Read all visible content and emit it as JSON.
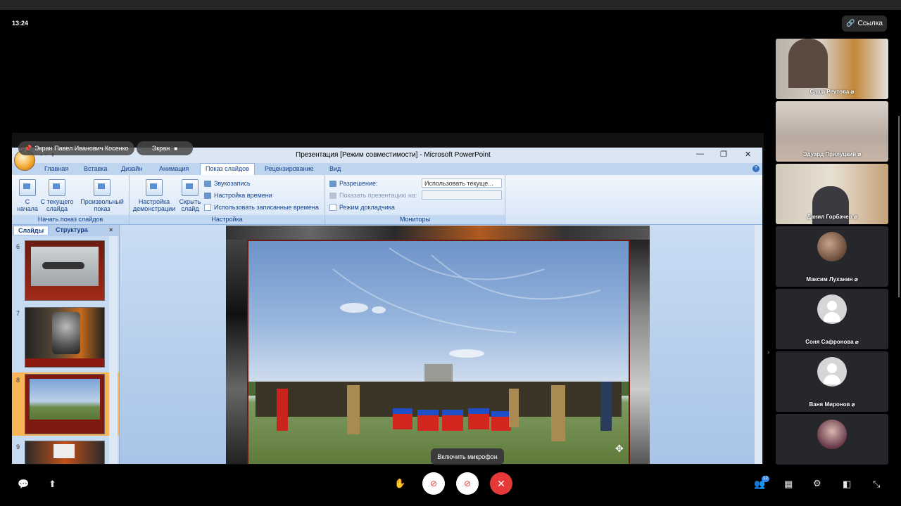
{
  "status": {
    "time": "13:24"
  },
  "header": {
    "link_button": "Ссылка"
  },
  "share": {
    "presenter_label": "Экран Павел Иванович Косенко",
    "screen_label": "Экран"
  },
  "ppt": {
    "window_title": "Презентация [Режим совместимости] - Microsoft PowerPoint",
    "tabs": [
      "Главная",
      "Вставка",
      "Дизайн",
      "Анимация",
      "Показ слайдов",
      "Рецензирование",
      "Вид"
    ],
    "active_tab": "Показ слайдов",
    "ribbon": {
      "start_group_title": "Начать показ слайдов",
      "from_start": "С начала",
      "from_current": "С текущего слайда",
      "custom_show": "Произвольный показ",
      "setup_group_title": "Настройка",
      "setup_show": "Настройка демонстрации",
      "hide_slide": "Скрыть слайд",
      "record_narration": "Звукозапись",
      "rehearse_timings": "Настройка времени",
      "use_timings": "Использовать записанные времена",
      "monitors_group_title": "Мониторы",
      "resolution_label": "Разрешение:",
      "resolution_value": "Использовать текуще...",
      "show_on_label": "Показать презентацию на:",
      "presenter_view": "Режим докладчика"
    },
    "panel": {
      "tab_slides": "Слайды",
      "tab_outline": "Структура",
      "slide_numbers": [
        "6",
        "7",
        "8",
        "9"
      ],
      "selected_slide": "8"
    }
  },
  "participants": [
    {
      "name": "Саша Реутова",
      "type": "video",
      "muted": true
    },
    {
      "name": "Эдуард Прилуцкий",
      "type": "video",
      "muted": true
    },
    {
      "name": "Данил Горбачев",
      "type": "video",
      "muted": true
    },
    {
      "name": "Максим Луханин",
      "type": "photo",
      "muted": true
    },
    {
      "name": "Соня Сафронова",
      "type": "placeholder",
      "muted": true
    },
    {
      "name": "Ваня Миронов",
      "type": "placeholder",
      "muted": true
    },
    {
      "name": "",
      "type": "photo",
      "muted": false
    }
  ],
  "controls": {
    "mic_tooltip": "Включить микрофон",
    "participants_badge": "12",
    "end_call_color": "#e63a3a"
  }
}
